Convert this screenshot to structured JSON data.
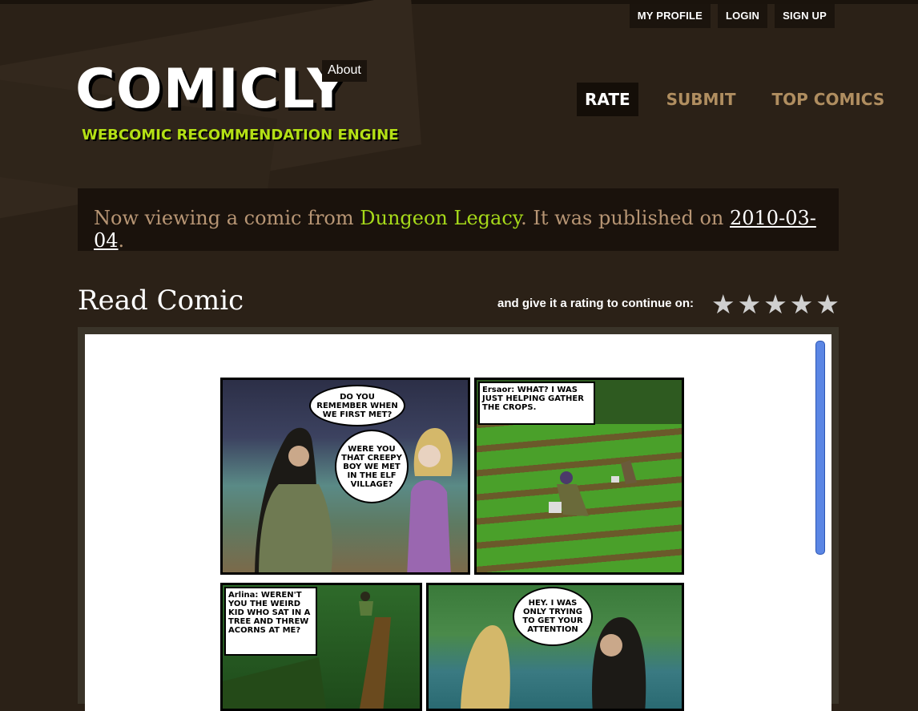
{
  "top_nav": {
    "profile": "MY PROFILE",
    "login": "LOGIN",
    "signup": "SIGN UP"
  },
  "logo": {
    "title": "COMICLY",
    "tagline": "WEBCOMIC RECOMMENDATION ENGINE",
    "about": "About"
  },
  "main_nav": {
    "rate": "RATE",
    "submit": "SUBMIT",
    "top": "TOP COMICS",
    "active": "RATE"
  },
  "info": {
    "prefix": "Now viewing a comic from ",
    "comic": "Dungeon Legacy",
    "middle": ". It was published on ",
    "date": "2010-03-04",
    "suffix": "."
  },
  "read": {
    "title": "Read Comic",
    "rating_prompt": "and give it a rating to continue on:",
    "stars_total": 5
  },
  "comic": {
    "panel1": {
      "bubble1": "DO YOU REMEMBER WHEN WE FIRST MET?",
      "bubble2": "WERE YOU THAT CREEPY BOY WE MET IN THE ELF VILLAGE?"
    },
    "panel2": {
      "caption": "Ersaor: WHAT? I WAS JUST HELPING GATHER THE CROPS."
    },
    "panel3": {
      "caption": "Arlina: WEREN'T YOU THE WEIRD KID WHO SAT IN A TREE AND THREW ACORNS AT ME?"
    },
    "panel4": {
      "bubble": "HEY. I WAS ONLY TRYING TO GET YOUR ATTENTION"
    }
  },
  "colors": {
    "background": "#2b2117",
    "accent_green": "#a6d91a",
    "nav_inactive": "#b08e60",
    "info_text": "#b79574"
  }
}
